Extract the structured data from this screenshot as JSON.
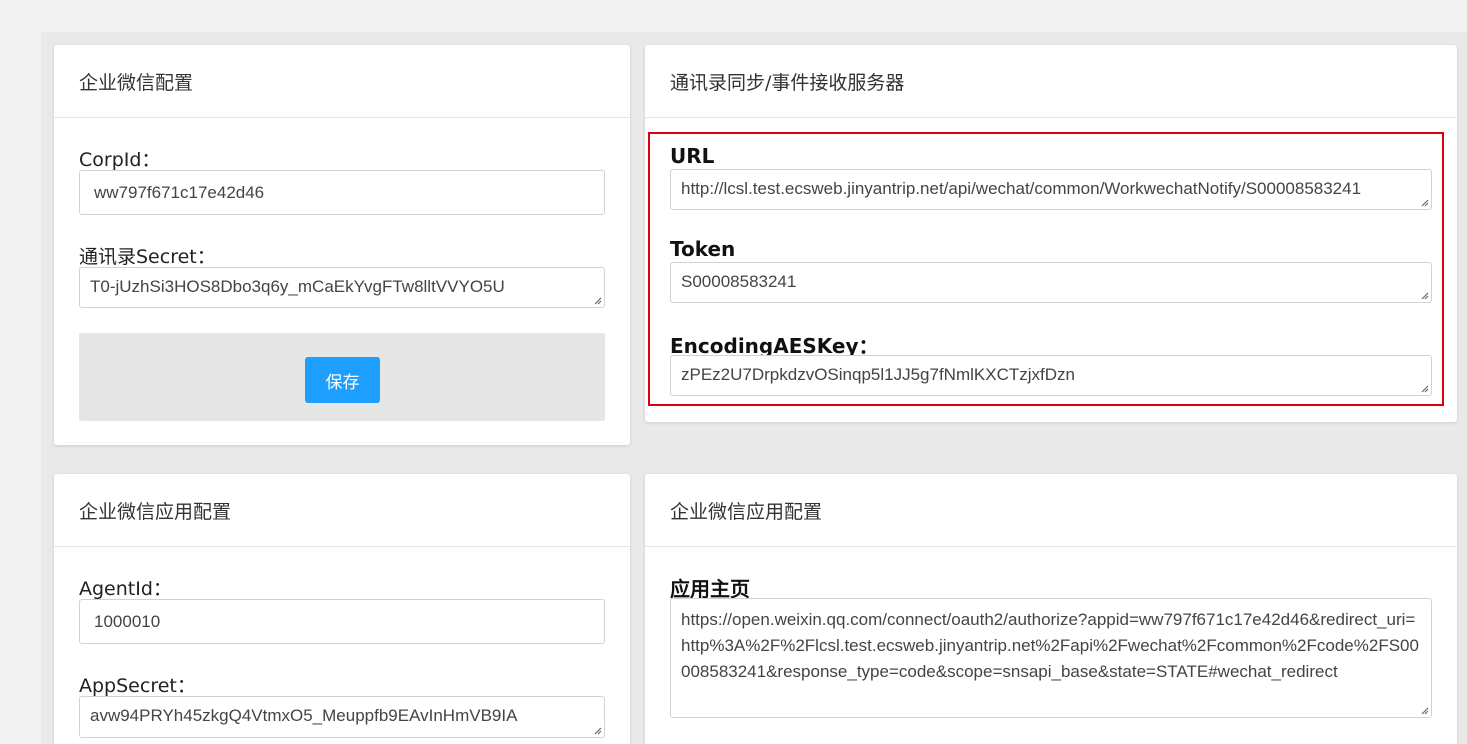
{
  "wecom_config": {
    "title": "企业微信配置",
    "corpid_label": "CorpId：",
    "corpid_value": "ww797f671c17e42d46",
    "contacts_secret_label": "通讯录Secret：",
    "contacts_secret_value": "T0-jUzhSi3HOS8Dbo3q6y_mCaEkYvgFTw8lltVVYO5U",
    "save_label": "保存"
  },
  "sync_server": {
    "title": "通讯录同步/事件接收服务器",
    "url_label": "URL",
    "url_value": "http://lcsl.test.ecsweb.jinyantrip.net/api/wechat/common/WorkwechatNotify/S00008583241",
    "token_label": "Token",
    "token_value": "S00008583241",
    "aeskey_label": "EncodingAESKey：",
    "aeskey_value": "zPEz2U7DrpkdzvOSinqp5l1JJ5g7fNmlKXCTzjxfDzn",
    "highlight_color": "#d9000d"
  },
  "app_config": {
    "title": "企业微信应用配置",
    "agentid_label": "AgentId：",
    "agentid_value": "1000010",
    "appsecret_label": "AppSecret：",
    "appsecret_value": "avw94PRYh45zkgQ4VtmxO5_Meuppfb9EAvInHmVB9IA"
  },
  "app_home": {
    "title": "企业微信应用配置",
    "home_label": "应用主页",
    "home_value": "https://open.weixin.qq.com/connect/oauth2/authorize?appid=ww797f671c17e42d46&redirect_uri=http%3A%2F%2Flcsl.test.ecsweb.jinyantrip.net%2Fapi%2Fwechat%2Fcommon%2Fcode%2FS00008583241&response_type=code&scope=snsapi_base&state=STATE#wechat_redirect"
  },
  "colors": {
    "button": "#1e9fff",
    "background": "#e9e9e9"
  }
}
